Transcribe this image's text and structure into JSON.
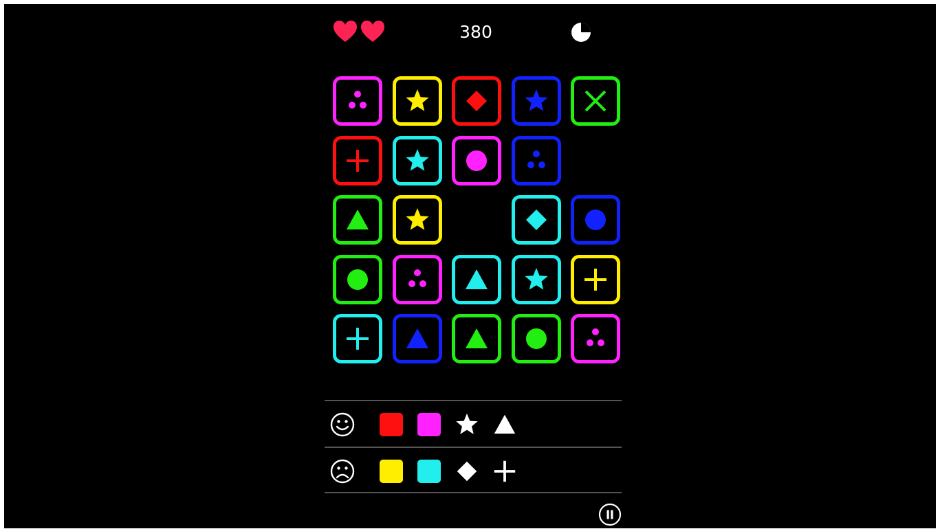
{
  "header": {
    "lives": 2,
    "lives_icon": "heart-icon",
    "score": "380",
    "timer_icon": "pie-timer-icon",
    "timer_elapsed_fraction": 0.25
  },
  "colors": {
    "magenta": "#ff22ff",
    "yellow": "#ffee00",
    "red": "#ff1010",
    "blue": "#1122ff",
    "green": "#22ee11",
    "cyan": "#22eeee",
    "heart": "#ff2255",
    "white": "#ffffff"
  },
  "board": {
    "rows": 5,
    "cols": 5,
    "tiles": [
      {
        "row": 0,
        "col": 0,
        "color": "magenta",
        "symbol": "dots"
      },
      {
        "row": 0,
        "col": 1,
        "color": "yellow",
        "symbol": "star"
      },
      {
        "row": 0,
        "col": 2,
        "color": "red",
        "symbol": "diamond"
      },
      {
        "row": 0,
        "col": 3,
        "color": "blue",
        "symbol": "star"
      },
      {
        "row": 0,
        "col": 4,
        "color": "green",
        "symbol": "cross"
      },
      {
        "row": 1,
        "col": 0,
        "color": "red",
        "symbol": "plus"
      },
      {
        "row": 1,
        "col": 1,
        "color": "cyan",
        "symbol": "star"
      },
      {
        "row": 1,
        "col": 2,
        "color": "magenta",
        "symbol": "circle"
      },
      {
        "row": 1,
        "col": 3,
        "color": "blue",
        "symbol": "dots"
      },
      {
        "row": 2,
        "col": 0,
        "color": "green",
        "symbol": "triangle"
      },
      {
        "row": 2,
        "col": 1,
        "color": "yellow",
        "symbol": "star"
      },
      {
        "row": 2,
        "col": 3,
        "color": "cyan",
        "symbol": "diamond"
      },
      {
        "row": 2,
        "col": 4,
        "color": "blue",
        "symbol": "circle"
      },
      {
        "row": 3,
        "col": 0,
        "color": "green",
        "symbol": "circle"
      },
      {
        "row": 3,
        "col": 1,
        "color": "magenta",
        "symbol": "dots"
      },
      {
        "row": 3,
        "col": 2,
        "color": "cyan",
        "symbol": "triangle"
      },
      {
        "row": 3,
        "col": 3,
        "color": "cyan",
        "symbol": "star"
      },
      {
        "row": 3,
        "col": 4,
        "color": "yellow",
        "symbol": "plus"
      },
      {
        "row": 4,
        "col": 0,
        "color": "cyan",
        "symbol": "plus"
      },
      {
        "row": 4,
        "col": 1,
        "color": "blue",
        "symbol": "triangle"
      },
      {
        "row": 4,
        "col": 2,
        "color": "green",
        "symbol": "triangle"
      },
      {
        "row": 4,
        "col": 3,
        "color": "green",
        "symbol": "circle"
      },
      {
        "row": 4,
        "col": 4,
        "color": "magenta",
        "symbol": "dots"
      }
    ]
  },
  "rules": {
    "good": {
      "face_icon": "happy-face-icon",
      "colors": [
        "red",
        "magenta"
      ],
      "symbols": [
        "star",
        "triangle"
      ]
    },
    "bad": {
      "face_icon": "sad-face-icon",
      "colors": [
        "yellow",
        "cyan"
      ],
      "symbols": [
        "diamond",
        "plus"
      ]
    }
  },
  "controls": {
    "pause_icon": "pause-icon"
  }
}
